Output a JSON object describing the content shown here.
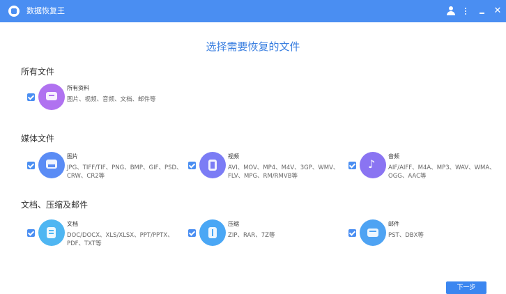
{
  "app": {
    "title": "数据恢复王"
  },
  "page_title": "选择需要恢复的文件",
  "sections": [
    {
      "title": "所有文件"
    },
    {
      "title": "媒体文件"
    },
    {
      "title": "文档、压缩及邮件"
    }
  ],
  "cards": {
    "all": {
      "name": "所有资料",
      "desc": "图片、视频、音频、文档、邮件等",
      "checked": true,
      "icon": "monitor-icon",
      "color": "#b072f0"
    },
    "image": {
      "name": "图片",
      "desc": "JPG、TIFF/TIF、PNG、BMP、GIF、PSD、CRW、CR2等",
      "checked": true,
      "icon": "image-icon",
      "color": "#5a8cf5"
    },
    "video": {
      "name": "视频",
      "desc": "AVI、MOV、MP4、M4V、3GP、WMV、FLV、MPG、RM/RMVB等",
      "checked": true,
      "icon": "film-icon",
      "color": "#7b7cf5"
    },
    "audio": {
      "name": "音频",
      "desc": "AIF/AIFF、M4A、MP3、WAV、WMA、OGG、AAC等",
      "checked": true,
      "icon": "music-note-icon",
      "color": "#8a74f2"
    },
    "document": {
      "name": "文档",
      "desc": "DOC/DOCX、XLS/XLSX、PPT/PPTX、PDF、TXT等",
      "checked": true,
      "icon": "document-icon",
      "color": "#4fb6f2"
    },
    "archive": {
      "name": "压缩",
      "desc": "ZIP、RAR、7Z等",
      "checked": true,
      "icon": "archive-icon",
      "color": "#4aa7f5"
    },
    "email": {
      "name": "邮件",
      "desc": "PST、DBX等",
      "checked": true,
      "icon": "envelope-icon",
      "color": "#4ea3f3"
    }
  },
  "next_button": "下一步"
}
